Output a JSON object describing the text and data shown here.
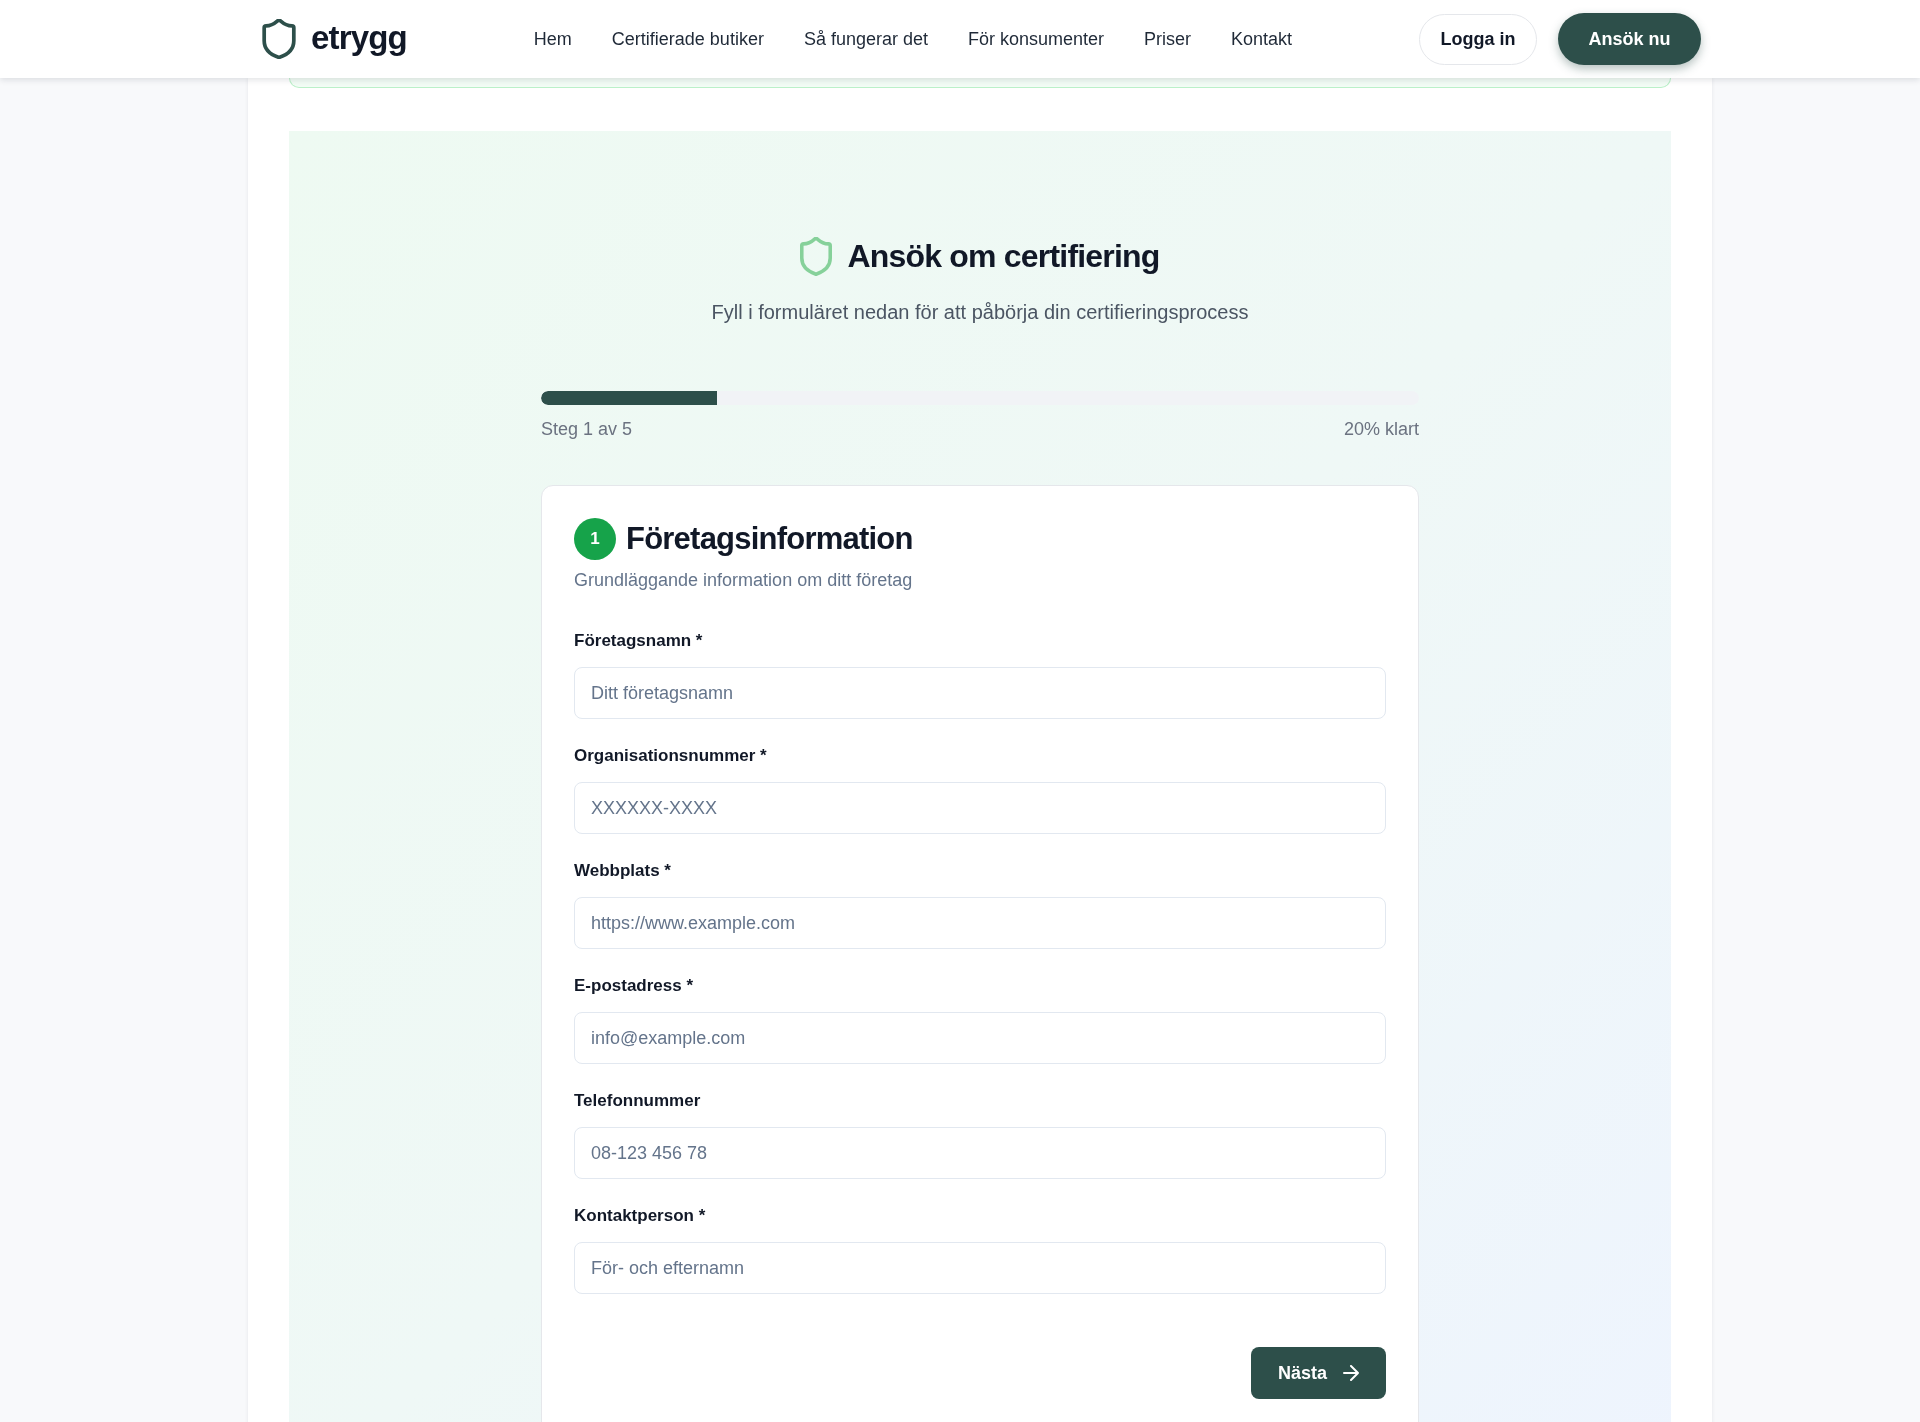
{
  "header": {
    "logo": "etrygg",
    "nav": [
      "Hem",
      "Certifierade butiker",
      "Så fungerar det",
      "För konsumenter",
      "Priser",
      "Kontakt"
    ],
    "login_button": "Logga in",
    "cta_button": "Ansök nu"
  },
  "hero": {
    "title": "Ansök om certifiering",
    "subtitle": "Fyll i formuläret nedan för att påbörja din certifieringsprocess"
  },
  "progress": {
    "level": 0.2,
    "step_label": "Steg 1 av 5",
    "percent_label": "20% klart"
  },
  "form": {
    "step_number": "1",
    "title": "Företagsinformation",
    "subtitle": "Grundläggande information om ditt företag",
    "fields": [
      {
        "label": "Företagsnamn *",
        "placeholder": "Ditt företagsnamn"
      },
      {
        "label": "Organisationsnummer *",
        "placeholder": "XXXXXX-XXXX"
      },
      {
        "label": "Webbplats *",
        "placeholder": "https://www.example.com"
      },
      {
        "label": "E-postadress *",
        "placeholder": "info@example.com"
      },
      {
        "label": "Telefonnummer",
        "placeholder": "08-123 456 78"
      },
      {
        "label": "Kontaktperson *",
        "placeholder": "För- och efternamn"
      }
    ],
    "next_button": "Nästa"
  }
}
